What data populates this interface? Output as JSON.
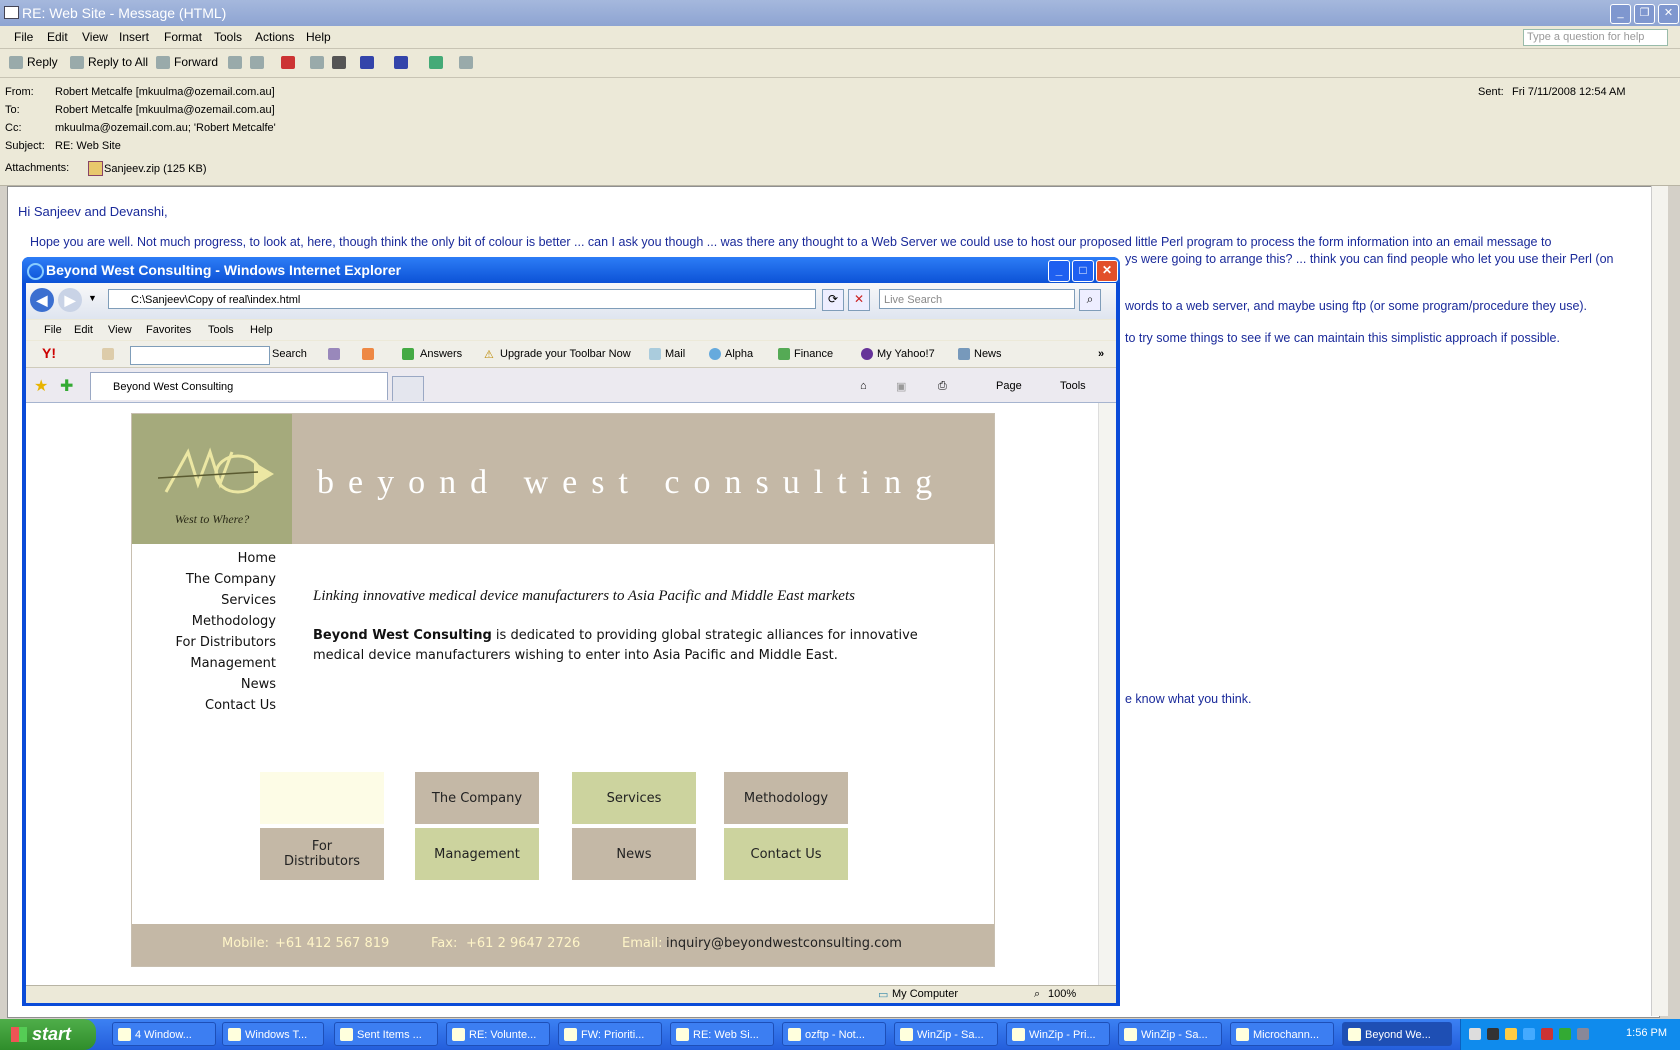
{
  "outlook": {
    "title": "RE: Web Site - Message (HTML)",
    "menu": [
      "File",
      "Edit",
      "View",
      "Insert",
      "Format",
      "Tools",
      "Actions",
      "Help"
    ],
    "help_placeholder": "Type a question for help",
    "toolbar": {
      "reply": "Reply",
      "reply_all": "Reply to All",
      "forward": "Forward"
    },
    "header": {
      "from_label": "From:",
      "from": "Robert Metcalfe [mkuulma@ozemail.com.au]",
      "to_label": "To:",
      "to": "Robert Metcalfe [mkuulma@ozemail.com.au]",
      "cc_label": "Cc:",
      "cc": "mkuulma@ozemail.com.au; 'Robert Metcalfe'",
      "subject_label": "Subject:",
      "subject": "RE: Web Site",
      "attachments_label": "Attachments:",
      "attachment": "Sanjeev.zip (125 KB)",
      "sent_label": "Sent:",
      "sent": "Fri 7/11/2008 12:54 AM"
    },
    "body": {
      "greeting": "Hi Sanjeev and Devanshi,",
      "line1": "Hope you are well.   Not much progress, to look at, here, though think the only bit of colour is better ... can I ask you though ... was there any thought to a Web Server we could use to host our proposed little Perl program to process the form information into an email message to",
      "line2": "ys were going to arrange this? ... think you can find people who let you use their Perl (on",
      "line3": "words to a web server, and maybe using ftp (or some program/procedure they use).",
      "line4": "to try some things to see if we can maintain this simplistic approach if possible.",
      "line5": "e know what you think."
    }
  },
  "ie": {
    "title": "Beyond West Consulting - Windows Internet Explorer",
    "address": "C:\\Sanjeev\\Copy of real\\index.html",
    "search_placeholder": "Live Search",
    "menu": [
      "File",
      "Edit",
      "View",
      "Favorites",
      "Tools",
      "Help"
    ],
    "ytoolbar": {
      "search": "Search",
      "answers": "Answers",
      "upgrade": "Upgrade your Toolbar Now",
      "mail": "Mail",
      "alpha": "Alpha",
      "finance": "Finance",
      "myyahoo": "My Yahoo!7",
      "news": "News"
    },
    "tab": "Beyond West Consulting",
    "cmd": {
      "page": "Page",
      "tools": "Tools"
    },
    "status": {
      "zone": "My Computer",
      "zoom": "100%"
    }
  },
  "site": {
    "logo_text": "BWC",
    "logo_tagline": "West to Where?",
    "title": "beyond west consulting",
    "nav": [
      "Home",
      "The Company",
      "Services",
      "Methodology",
      "For Distributors",
      "Management",
      "News",
      "Contact Us"
    ],
    "tagline": "Linking innovative medical device manufacturers to Asia Pacific and Middle East markets",
    "intro_bold": "Beyond West Consulting",
    "intro_rest": " is dedicated to providing global strategic alliances for innovative medical device manufacturers wishing to enter into Asia Pacific and Middle East.",
    "boxes": {
      "company": "The Company",
      "services": "Services",
      "methodology": "Methodology",
      "distributors": "For Distributors",
      "management": "Management",
      "news": "News",
      "contact": "Contact Us"
    },
    "footer": {
      "mobile_label": "Mobile:",
      "mobile": "+61 412 567 819",
      "fax_label": "Fax:",
      "fax": "+61 2 9647 2726",
      "email_label": "Email:",
      "email": "inquiry@beyondwestconsulting.com"
    },
    "colors": {
      "banner": "#c4b8a6",
      "logo_bg": "#a5aa7c",
      "green_box": "#ccd39e"
    }
  },
  "taskbar": {
    "start": "start",
    "tasks": [
      "4 Window...",
      "Windows T...",
      "Sent Items ...",
      "RE: Volunte...",
      "FW: Prioriti...",
      "RE: Web Si...",
      "ozftp - Not...",
      "WinZip - Sa...",
      "WinZip - Pri...",
      "WinZip - Sa...",
      "Microchann...",
      "Beyond We..."
    ],
    "clock": "1:56 PM"
  }
}
